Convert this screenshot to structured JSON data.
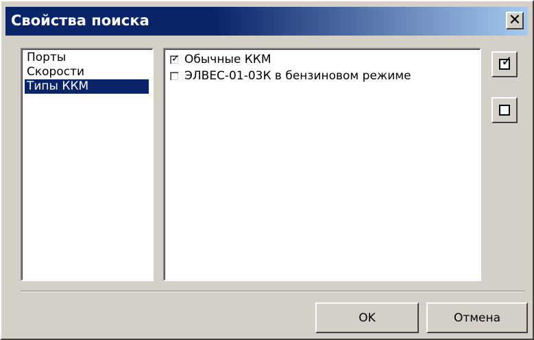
{
  "window": {
    "title": "Свойства поиска",
    "close_glyph": "✕"
  },
  "categories": {
    "items": [
      {
        "label": "Порты",
        "selected": false
      },
      {
        "label": "Скорости",
        "selected": false
      },
      {
        "label": "Типы ККМ",
        "selected": true
      }
    ]
  },
  "types": {
    "items": [
      {
        "label": "Обычные ККМ",
        "checked": true
      },
      {
        "label": "ЭЛВЕС-01-03К в бензиновом режиме",
        "checked": false
      }
    ]
  },
  "side_buttons": {
    "check_all_icon": "checked-box-icon",
    "uncheck_all_icon": "empty-box-icon"
  },
  "footer": {
    "ok_label": "OK",
    "cancel_label": "Отмена"
  },
  "colors": {
    "title_bar": "#0a246a",
    "selection": "#0a246a",
    "face": "#d4d0c8"
  }
}
